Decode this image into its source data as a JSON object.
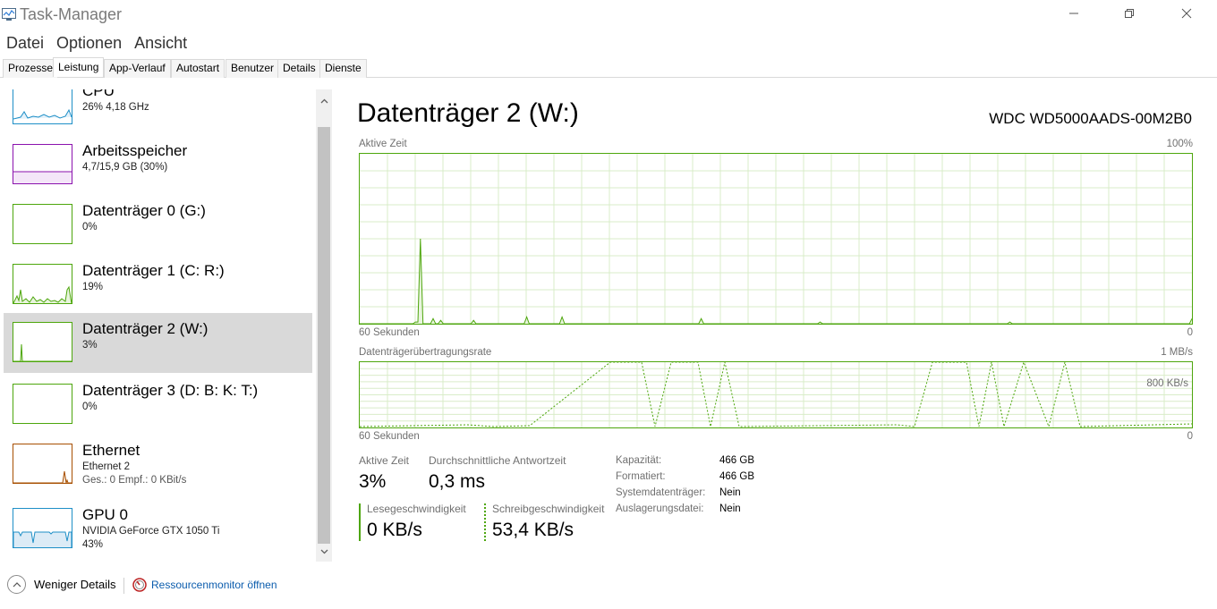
{
  "window": {
    "title": "Task-Manager",
    "controls": [
      "minimize",
      "restore",
      "close"
    ]
  },
  "menu": [
    "Datei",
    "Optionen",
    "Ansicht"
  ],
  "tabs": [
    {
      "label": "Prozesse",
      "active": false
    },
    {
      "label": "Leistung",
      "active": true
    },
    {
      "label": "App-Verlauf",
      "active": false
    },
    {
      "label": "Autostart",
      "active": false
    },
    {
      "label": "Benutzer",
      "active": false
    },
    {
      "label": "Details",
      "active": false
    },
    {
      "label": "Dienste",
      "active": false
    }
  ],
  "sidebar": {
    "items": [
      {
        "name": "CPU",
        "sub1": "26%  4,18 GHz",
        "sub2": "",
        "color": "#1e8fc7",
        "selected": false
      },
      {
        "name": "Arbeitsspeicher",
        "sub1": "4,7/15,9 GB (30%)",
        "sub2": "",
        "color": "#8b12ae",
        "selected": false
      },
      {
        "name": "Datenträger 0 (G:)",
        "sub1": "0%",
        "sub2": "",
        "color": "#4da60c",
        "selected": false
      },
      {
        "name": "Datenträger 1 (C: R:)",
        "sub1": "19%",
        "sub2": "",
        "color": "#4da60c",
        "selected": false
      },
      {
        "name": "Datenträger 2 (W:)",
        "sub1": "3%",
        "sub2": "",
        "color": "#4da60c",
        "selected": true
      },
      {
        "name": "Datenträger 3 (D: B: K: T:)",
        "sub1": "0%",
        "sub2": "",
        "color": "#4da60c",
        "selected": false
      },
      {
        "name": "Ethernet",
        "sub1": "Ethernet 2",
        "sub2": "Ges.: 0 Empf.: 0 KBit/s",
        "color": "#a74f01",
        "selected": false
      },
      {
        "name": "GPU 0",
        "sub1": "NVIDIA GeForce GTX 1050 Ti",
        "sub2": "43%",
        "color": "#1e8fc7",
        "selected": false
      }
    ]
  },
  "detail": {
    "title": "Datenträger 2 (W:)",
    "model": "WDC WD5000AADS-00M2B0",
    "graph1": {
      "label": "Aktive Zeit",
      "max_label": "100%",
      "time_label": "60 Sekunden",
      "min_label": "0",
      "series": [
        0,
        0,
        0,
        0,
        0,
        0,
        0,
        0,
        0,
        0,
        0,
        0,
        0,
        0,
        0,
        0,
        0,
        0,
        0,
        0,
        0,
        0,
        1,
        1,
        50,
        0,
        0,
        0,
        0,
        3,
        0,
        0,
        2,
        0,
        0,
        0,
        0,
        0,
        0,
        0,
        0,
        0,
        0,
        0,
        0,
        2,
        0,
        0,
        0,
        0,
        0,
        0,
        0,
        0,
        0,
        0,
        0,
        0,
        0,
        0,
        0,
        0,
        0,
        0,
        0,
        0,
        4,
        0,
        0,
        0,
        0,
        0,
        0,
        0,
        0,
        0,
        0,
        0,
        0,
        0,
        4,
        0,
        0,
        0,
        0,
        0,
        0,
        0,
        0,
        0,
        0,
        0,
        0,
        0,
        0,
        0,
        0,
        0,
        0,
        0,
        0,
        0,
        0,
        0,
        0,
        0,
        0,
        0,
        0,
        0,
        0,
        0,
        0,
        0,
        0,
        0,
        0,
        0,
        0,
        0,
        0,
        0,
        0,
        0,
        0,
        0,
        0,
        0,
        0,
        0,
        0,
        0,
        0,
        0,
        0,
        3,
        0,
        0,
        0,
        0,
        0,
        0,
        0,
        0,
        0,
        0,
        0,
        0,
        0,
        0,
        0,
        0,
        0,
        0,
        0,
        0,
        0,
        0,
        0,
        0,
        0,
        0,
        0,
        0,
        0,
        0,
        0,
        0,
        0,
        0,
        0,
        0,
        0,
        0,
        0,
        0,
        0,
        0,
        0,
        0,
        0,
        0,
        1,
        0,
        0,
        0,
        0,
        0,
        0,
        0,
        0,
        0,
        0,
        0,
        0,
        0,
        0,
        0,
        0,
        0,
        0,
        0,
        0,
        0,
        0,
        0,
        0,
        0,
        0,
        0,
        0,
        0,
        0,
        0,
        0,
        0,
        0,
        0,
        0,
        0,
        0,
        0,
        0,
        0,
        0,
        0,
        0,
        0,
        0,
        0,
        0,
        0,
        0,
        0,
        0,
        0,
        0,
        0,
        0,
        0,
        0,
        0,
        0,
        0,
        0,
        0,
        0,
        0,
        0,
        0,
        0,
        0,
        0,
        0,
        0,
        0,
        0,
        1,
        0,
        0,
        0,
        0,
        0,
        0,
        0,
        0,
        0,
        0,
        0,
        0,
        0,
        0,
        0,
        0,
        0,
        0,
        0,
        0,
        0,
        0,
        0,
        0,
        0,
        0,
        0,
        0,
        0,
        0,
        0,
        0,
        0,
        0,
        0,
        0,
        0,
        0,
        0,
        0,
        0,
        0,
        0,
        0,
        0,
        0,
        0,
        0,
        0,
        0,
        0,
        0,
        0,
        0,
        0,
        0,
        0,
        0,
        0,
        0,
        0,
        0,
        0,
        0,
        0,
        0,
        0,
        0,
        0,
        0,
        0,
        3
      ]
    },
    "graph2": {
      "label": "Datenträgerübertragungsrate",
      "max_label": "1 MB/s",
      "secondary_label": "800 KB/s",
      "time_label": "60 Sekunden",
      "min_label": "0"
    },
    "stats": {
      "active_time_label": "Aktive Zeit",
      "active_time_value": "3%",
      "avg_response_label": "Durchschnittliche Antwortzeit",
      "avg_response_value": "0,3 ms",
      "read_label": "Lesegeschwindigkeit",
      "read_value": "0 KB/s",
      "write_label": "Schreibgeschwindigkeit",
      "write_value": "53,4 KB/s"
    },
    "properties": [
      {
        "label": "Kapazität:",
        "value": "466 GB"
      },
      {
        "label": "Formatiert:",
        "value": "466 GB"
      },
      {
        "label": "Systemdatenträger:",
        "value": "Nein"
      },
      {
        "label": "Auslagerungsdatei:",
        "value": "Nein"
      }
    ]
  },
  "footer": {
    "less_details": "Weniger Details",
    "resource_monitor": "Ressourcenmonitor öffnen"
  },
  "colors": {
    "disk_green": "#4da60c",
    "grid_green": "#d9ecc9",
    "selection": "#d9d9d9",
    "link_blue": "#0b5cad"
  }
}
